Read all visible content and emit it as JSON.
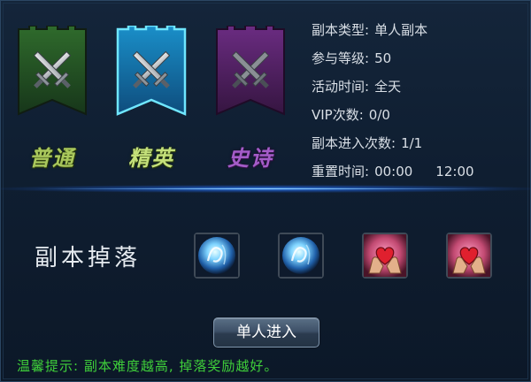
{
  "difficulties": [
    {
      "label": "普通",
      "color": "#2f6b2c",
      "icon": "crossed-swords-icon"
    },
    {
      "label": "精英",
      "color": "#1a8fc9",
      "icon": "crossed-swords-icon"
    },
    {
      "label": "史诗",
      "color": "#6b2c82",
      "icon": "crossed-swords-icon"
    }
  ],
  "selected_difficulty": "精英",
  "info": {
    "type_key": "副本类型:",
    "type_value": "单人副本",
    "level_key": "参与等级:",
    "level_value": "50",
    "time_key": "活动时间:",
    "time_value": "全天",
    "vip_key": "VIP次数:",
    "vip_value": "0/0",
    "enter_key": "副本进入次数:",
    "enter_value": "1/1",
    "reset_key": "重置时间:",
    "reset_value_1": "00:00",
    "reset_value_2": "12:00"
  },
  "drops": {
    "title": "副本掉落",
    "items": [
      {
        "icon": "blue-orb-icon"
      },
      {
        "icon": "blue-orb-icon"
      },
      {
        "icon": "heart-in-hands-icon"
      },
      {
        "icon": "heart-in-hands-icon"
      }
    ]
  },
  "enter_button": "单人进入",
  "tip": "温馨提示: 副本难度越高, 掉落奖励越好。",
  "colors": {
    "tip": "#3fcf3a",
    "accent_line": "#4a9bff"
  }
}
